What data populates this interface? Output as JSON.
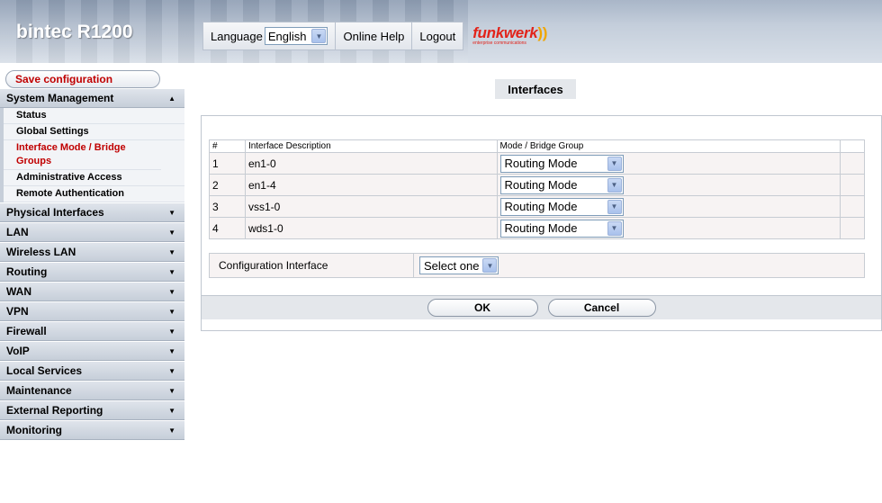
{
  "header": {
    "brand": "bintec R1200",
    "language_label": "Language",
    "language_value": "English",
    "online_help": "Online Help",
    "logout": "Logout",
    "logo_word": "funkwerk",
    "logo_tagline": "enterprise communications"
  },
  "sidebar": {
    "save_label": "Save configuration",
    "sections": [
      {
        "label": "System Management",
        "expanded": true
      },
      {
        "label": "Physical Interfaces"
      },
      {
        "label": "LAN"
      },
      {
        "label": "Wireless LAN"
      },
      {
        "label": "Routing"
      },
      {
        "label": "WAN"
      },
      {
        "label": "VPN"
      },
      {
        "label": "Firewall"
      },
      {
        "label": "VoIP"
      },
      {
        "label": "Local Services"
      },
      {
        "label": "Maintenance"
      },
      {
        "label": "External Reporting"
      },
      {
        "label": "Monitoring"
      }
    ],
    "sub_items": [
      {
        "label": "Status"
      },
      {
        "label": "Global Settings"
      },
      {
        "label": "Interface Mode / Bridge Groups",
        "active": true
      },
      {
        "label": "Administrative Access"
      },
      {
        "label": "Remote Authentication"
      }
    ]
  },
  "main": {
    "title": "Interfaces",
    "table": {
      "headers": [
        "#",
        "Interface Description",
        "Mode / Bridge Group",
        ""
      ],
      "rows": [
        {
          "num": "1",
          "desc": "en1-0",
          "mode": "Routing Mode"
        },
        {
          "num": "2",
          "desc": "en1-4",
          "mode": "Routing Mode"
        },
        {
          "num": "3",
          "desc": "vss1-0",
          "mode": "Routing Mode"
        },
        {
          "num": "4",
          "desc": "wds1-0",
          "mode": "Routing Mode"
        }
      ]
    },
    "config_interface": {
      "label": "Configuration Interface",
      "value": "Select one"
    },
    "buttons": {
      "ok": "OK",
      "cancel": "Cancel"
    }
  },
  "colors": {
    "accent_red": "#c00000",
    "header_bg": "#c4cedb",
    "nav_bg": "#c6ced9"
  }
}
